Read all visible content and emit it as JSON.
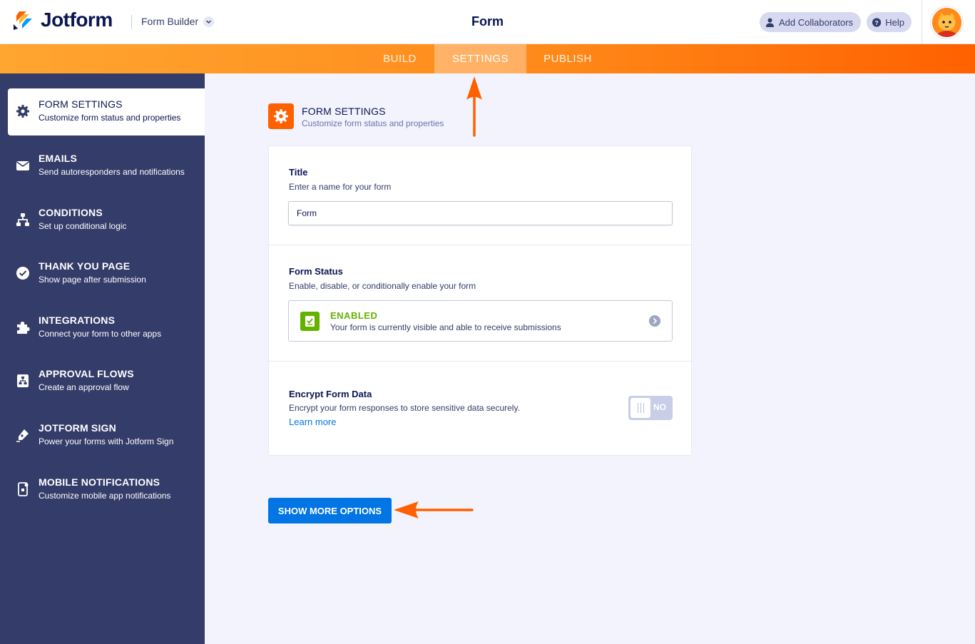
{
  "header": {
    "brand": "Jotform",
    "builder_label": "Form Builder",
    "form_title": "Form",
    "add_collaborators": "Add Collaborators",
    "help": "Help"
  },
  "tabs": [
    {
      "label": "BUILD",
      "active": false
    },
    {
      "label": "SETTINGS",
      "active": true
    },
    {
      "label": "PUBLISH",
      "active": false
    }
  ],
  "sidebar": {
    "items": [
      {
        "title": "FORM SETTINGS",
        "desc": "Customize form status and properties",
        "icon": "gear-icon",
        "active": true
      },
      {
        "title": "EMAILS",
        "desc": "Send autoresponders and notifications",
        "icon": "envelope-icon"
      },
      {
        "title": "CONDITIONS",
        "desc": "Set up conditional logic",
        "icon": "flow-icon"
      },
      {
        "title": "THANK YOU PAGE",
        "desc": "Show page after submission",
        "icon": "check-circle-icon"
      },
      {
        "title": "INTEGRATIONS",
        "desc": "Connect your form to other apps",
        "icon": "puzzle-icon"
      },
      {
        "title": "APPROVAL FLOWS",
        "desc": "Create an approval flow",
        "icon": "approval-icon"
      },
      {
        "title": "JOTFORM SIGN",
        "desc": "Power your forms with Jotform Sign",
        "icon": "pen-icon"
      },
      {
        "title": "MOBILE NOTIFICATIONS",
        "desc": "Customize mobile app notifications",
        "icon": "mobile-icon"
      }
    ]
  },
  "main": {
    "section_title": "FORM SETTINGS",
    "section_desc": "Customize form status and properties",
    "title_field": {
      "label": "Title",
      "desc": "Enter a name for your form",
      "value": "Form"
    },
    "form_status": {
      "label": "Form Status",
      "desc": "Enable, disable, or conditionally enable your form",
      "status": "ENABLED",
      "status_desc": "Your form is currently visible and able to receive submissions"
    },
    "encrypt": {
      "label": "Encrypt Form Data",
      "desc": "Encrypt your form responses to store sensitive data securely.",
      "link": "Learn more",
      "toggle": "NO"
    },
    "more_button": "SHOW MORE OPTIONS"
  },
  "colors": {
    "accent": "#ff6100",
    "sidebar": "#343c6a",
    "primary_button": "#0075e3",
    "enabled": "#64b200"
  }
}
